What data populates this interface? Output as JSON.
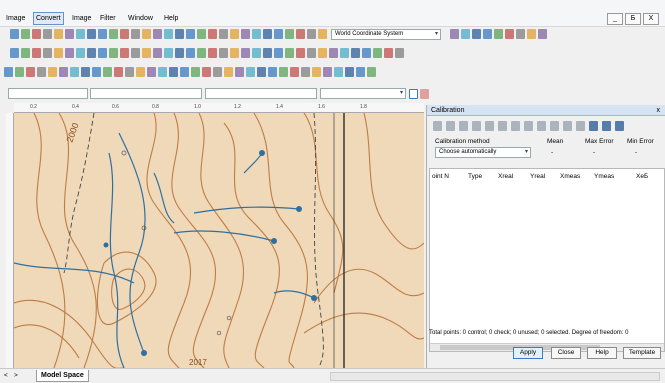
{
  "menubar": {
    "items": [
      "Image",
      "Convert",
      "Image",
      "Filter",
      "Window",
      "Help"
    ],
    "active_index": 1,
    "window_controls": [
      "_",
      "Б",
      "X"
    ]
  },
  "toolbar": {
    "coordinate_system": "World Coordinate System"
  },
  "ruler": {
    "ticks": [
      "0.2",
      "0.4",
      "0.6",
      "0.8",
      "1.0",
      "1.2",
      "1.4",
      "1.6",
      "1.8"
    ]
  },
  "map": {
    "label_top": "2000",
    "label_bottom": "2017"
  },
  "status": {
    "tab_label": "Model Space"
  },
  "calibration": {
    "title": "Calibration",
    "close": "x",
    "method_label": "Calibration method",
    "method_value": "Choose automatically",
    "stats": {
      "mean": "Mean",
      "max_error": "Max Error",
      "min_error": "Min Error",
      "mean_value": "-",
      "max_value": "-",
      "min_value": "-"
    },
    "columns": [
      "oint N",
      "Type",
      "Xreal",
      "Yreal",
      "Xmeas",
      "Ymeas",
      "XeБ"
    ],
    "summary": "Total points: 0 control; 0 check; 0 unused; 0 selected. Degree of freedom: 0",
    "buttons": {
      "apply": "Apply",
      "close": "Close",
      "help": "Help",
      "template": "Template"
    }
  },
  "colors": {
    "map_paper": "#efd9b8",
    "contour": "#b76b32",
    "river": "#2f6fa0",
    "title_bar": "#d5e3f3"
  }
}
